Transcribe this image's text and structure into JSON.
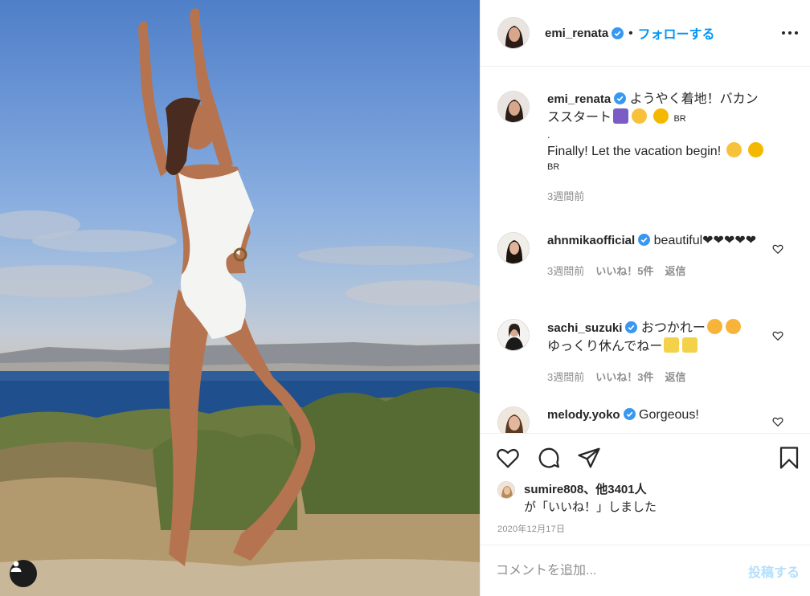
{
  "post": {
    "username": "emi_renata",
    "follow_label": "フォローする",
    "separator": "•",
    "more_icon": "more-horizontal-icon",
    "user_tag_icon": "user-tag-icon"
  },
  "caption": {
    "username": "emi_renata",
    "line1": "ようやく着地！バカンススタート",
    "flag1": "BR",
    "dot_line": ".",
    "line2": "Finally! Let the vacation begin!",
    "flag2": "BR",
    "time": "3週間前"
  },
  "comments": [
    {
      "username": "ahnmikaofficial",
      "text": "beautiful❤❤❤❤❤",
      "time": "3週間前",
      "likes": "いいね！5件",
      "reply": "返信"
    },
    {
      "username": "sachi_suzuki",
      "text_a": "おつかれー",
      "text_b": "ゆっくり休んでねー",
      "time": "3週間前",
      "likes": "いいね！3件",
      "reply": "返信"
    },
    {
      "username": "melody.yoko",
      "text": "Gorgeous!"
    }
  ],
  "actions": {
    "like_icon": "heart-icon",
    "comment_icon": "comment-icon",
    "share_icon": "paper-plane-icon",
    "save_icon": "bookmark-icon"
  },
  "likes": {
    "user": "sumire808",
    "sep": "、",
    "others": "他3401人",
    "suffix": "が「いいね！」しました"
  },
  "date": "2020年12月17日",
  "add_comment": {
    "placeholder": "コメントを追加...",
    "post_label": "投稿する"
  },
  "colors": {
    "accent": "#0095f6",
    "post_disabled": "#b2dffc",
    "secondary_text": "#8e8e8e",
    "verified": "#3897f0"
  }
}
